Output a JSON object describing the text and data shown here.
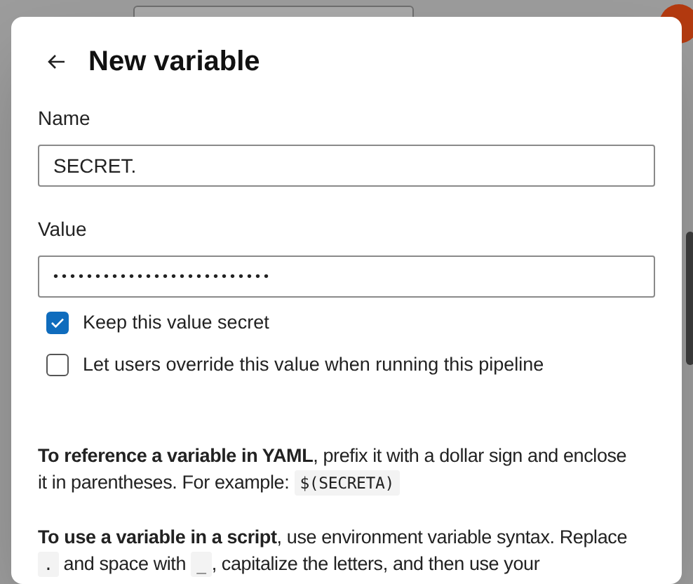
{
  "panel": {
    "title": "New variable"
  },
  "fields": [
    {
      "label": "Name",
      "value": "SECRET.",
      "kind": "text"
    },
    {
      "label": "Value",
      "value": "••••••••••••••••••••••••••",
      "kind": "password"
    }
  ],
  "options": [
    {
      "label": "Keep this value secret",
      "checked": true
    },
    {
      "label": "Let users override this value when running this pipeline",
      "checked": false
    }
  ],
  "help": [
    [
      {
        "kind": "bold",
        "text": "To reference a variable in YAML"
      },
      {
        "kind": "text",
        "text": ", prefix it with a dollar sign and enclose it in parentheses. For example: "
      },
      {
        "kind": "code",
        "text": "$(SECRETA)"
      }
    ],
    [
      {
        "kind": "bold",
        "text": "To use a variable in a script"
      },
      {
        "kind": "text",
        "text": ", use environment variable syntax. Replace "
      },
      {
        "kind": "code",
        "text": "."
      },
      {
        "kind": "text",
        "text": " and space with "
      },
      {
        "kind": "code",
        "text": "_"
      },
      {
        "kind": "text",
        "text": ", capitalize the letters, and then use your"
      }
    ]
  ]
}
